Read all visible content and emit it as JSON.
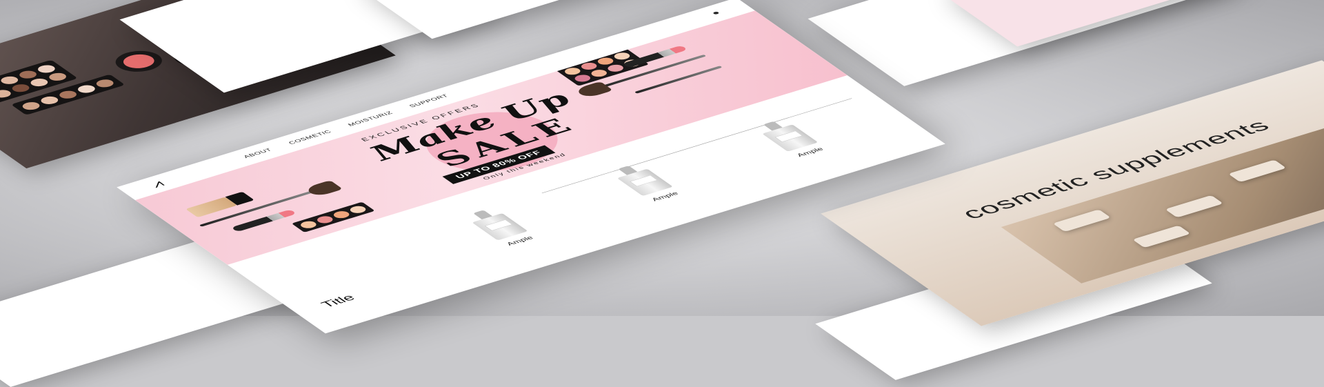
{
  "main": {
    "header": {
      "logo": "⩘",
      "nav": [
        "ABOUT",
        "COSMETIC",
        "MOISTURIZ",
        "SUPPORT"
      ],
      "user_icon": "user-icon"
    },
    "banner": {
      "offers": "EXCLUSIVE OFFERS",
      "headline": "Make Up",
      "sale": "SALE",
      "discount": "UP TO 80% OFF",
      "note": "Only this weekend"
    },
    "products": {
      "title": "Title",
      "items": [
        {
          "name": "Ample"
        },
        {
          "name": "Ample"
        },
        {
          "name": "Ample"
        }
      ]
    }
  },
  "side_right": {
    "text": "cosmetic supplements"
  },
  "colors": {
    "banner_pink": "#f7c9d5",
    "accent_black": "#111111",
    "beige": "#dccab9"
  },
  "icons": {
    "arrow": "arrow-up-right-icon"
  }
}
